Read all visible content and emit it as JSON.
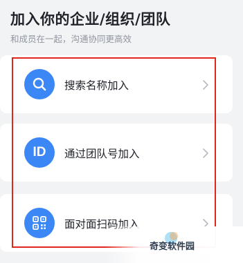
{
  "header": {
    "title": "加入你的企业/组织/团队",
    "subtitle": "和成员在一起，沟通协同更高效"
  },
  "options": [
    {
      "label": "搜索名称加入",
      "icon": "search-icon"
    },
    {
      "label": "通过团队号加入",
      "icon": "id-icon",
      "icon_text": "ID"
    },
    {
      "label": "面对面扫码加入",
      "icon": "qr-code-icon"
    }
  ],
  "watermark": {
    "text": "奇变软件园"
  },
  "colors": {
    "accent": "#3b87f5",
    "highlight": "#e0261b",
    "background": "#f2f3f5"
  }
}
